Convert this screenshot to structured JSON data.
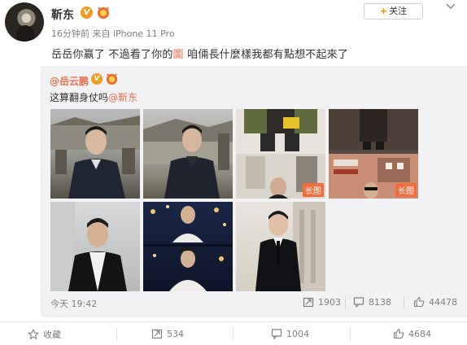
{
  "post": {
    "username": "靳东",
    "meta": "16分钟前 来自 iPhone 11 Pro",
    "follow_label": "关注",
    "text_prefix": "岳岳你赢了 不過看了你的",
    "text_link": "圖",
    "text_suffix": " 咱倆長什麼樣我都有點想不起來了"
  },
  "repost": {
    "username": "@岳云鹏",
    "text_prefix": "这算翻身仗吗",
    "mention": "@靳东",
    "long_image_label": "长图",
    "time": "今天 19:42",
    "share_count": "1903",
    "comment_count": "8138",
    "like_count": "44478"
  },
  "actions": {
    "favorite_label": "收藏",
    "share_count": "534",
    "comment_count": "1004",
    "like_count": "4684"
  },
  "colors": {
    "link": "#eb7350",
    "vip_badge": "#f29c1f",
    "follow_plus": "#ff8200",
    "long_image_badge": "#f26d3d"
  }
}
